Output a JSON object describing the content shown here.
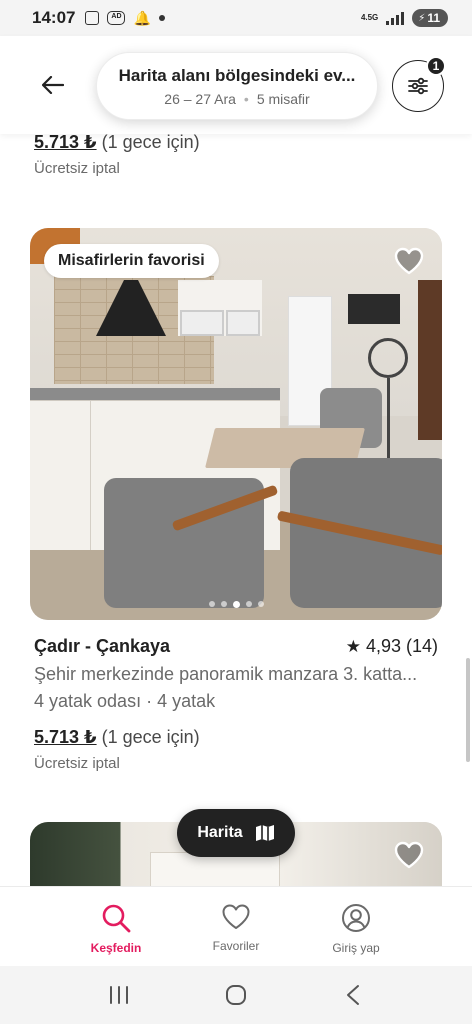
{
  "status_bar": {
    "time": "14:07",
    "network": "4.5G",
    "battery": "11"
  },
  "header": {
    "search_title": "Harita alanı bölgesindeki ev...",
    "dates": "26 – 27 Ara",
    "guests": "5 misafir",
    "filter_badge_count": "1"
  },
  "prev_listing": {
    "price": "5.713 ₺",
    "price_period": "(1 gece için)",
    "cancellation": "Ücretsiz iptal"
  },
  "listing": {
    "badge": "Misafirlerin favorisi",
    "title": "Çadır - Çankaya",
    "rating": "4,93 (14)",
    "description": "Şehir merkezinde panoramik manzara 3. katta...",
    "beds": "4 yatak odası · 4 yatak",
    "price": "5.713 ₺",
    "price_period": "(1 gece için)",
    "cancellation": "Ücretsiz iptal",
    "photo_count": 5,
    "active_photo_index": 2
  },
  "map_button": {
    "label": "Harita"
  },
  "bottom_nav": {
    "items": [
      {
        "label": "Keşfedin",
        "icon": "search-icon",
        "active": true
      },
      {
        "label": "Favoriler",
        "icon": "heart-icon",
        "active": false
      },
      {
        "label": "Giriş yap",
        "icon": "profile-icon",
        "active": false
      }
    ]
  },
  "colors": {
    "accent": "#e31c5f",
    "text": "#222222",
    "muted": "#6a6a6a",
    "map_button": "#222222"
  }
}
